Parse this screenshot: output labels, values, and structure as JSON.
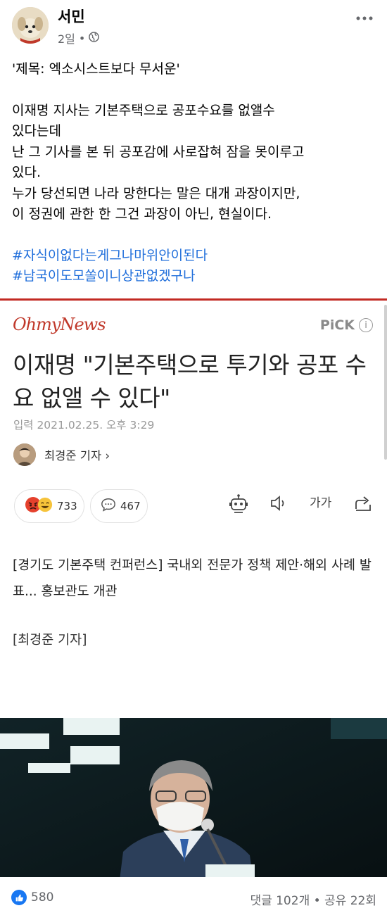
{
  "post": {
    "author": "서민",
    "time": "2일",
    "dot": "•",
    "lines": [
      "'제목: 엑소시스트보다 무서운'",
      "이재명 지사는 기본주택으로 공포수요를 없앨수\n있다는데\n난 그 기사를 본 뒤 공포감에 사로잡혀 잠을 못이루고\n있다.\n누가 당선되면 나라 망한다는 말은 대개 과장이지만,\n이 정권에 관한 한 그건 과장이 아닌, 현실이다."
    ],
    "hashtags": [
      "#자식이없다는게그나마위안이된다",
      "#남국이도모쏠이니상관없겠구나"
    ]
  },
  "article": {
    "logo": "OhmyNews",
    "pick": "PiCK",
    "pick_info": "i",
    "headline": "이재명 \"기본주택으로 투기와 공포 수요 없앨 수 있다\"",
    "date": "입력 2021.02.25. 오후 3:29",
    "reporter": "최경준 기자 ›",
    "reactions_count": "733",
    "comments_count": "467",
    "font_size_label": "가가",
    "subhead": "[경기도 기본주택 컨퍼런스] 국내외 전문가 정책 제안·해외 사례 발표... 홍보관도 개관",
    "byline": "[최경준 기자]"
  },
  "footer": {
    "likes": "580",
    "comments_shares": "댓글 102개 • 공유 22회"
  },
  "colors": {
    "hashtag": "#216fdb",
    "accent": "#c22a23",
    "like": "#1877f2"
  }
}
